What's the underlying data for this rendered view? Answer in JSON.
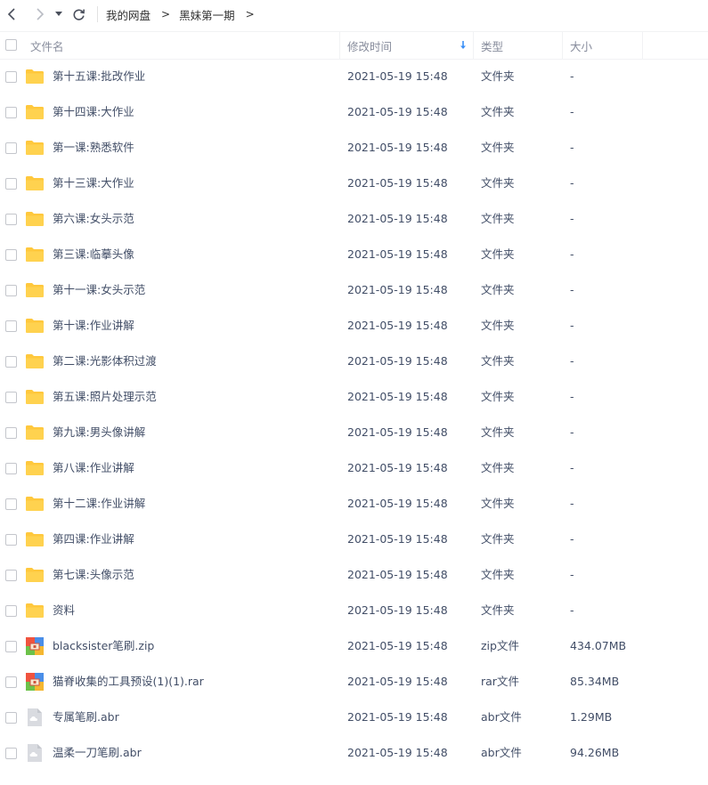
{
  "nav": {
    "back_icon": "chevron-left-icon",
    "forward_icon": "chevron-right-icon",
    "dropdown_icon": "caret-down-icon",
    "refresh_icon": "refresh-icon"
  },
  "breadcrumb": {
    "items": [
      "我的网盘",
      "黑妹第一期"
    ],
    "separator": ">"
  },
  "header": {
    "name": "文件名",
    "time": "修改时间",
    "type": "类型",
    "size": "大小",
    "sort_icon": "sort-down-arrow-icon"
  },
  "colors": {
    "folder": "#ffc83d",
    "zip_red": "#f0533f",
    "zip_green": "#6cc24a",
    "zip_blue": "#4a8ee8",
    "zip_yellow": "#f5b731",
    "abr": "#d9dbe0",
    "sort_arrow": "#3b8ff7"
  },
  "files": [
    {
      "name": "第十五课:批改作业",
      "time": "2021-05-19 15:48",
      "type": "文件夹",
      "size": "-",
      "icon": "folder"
    },
    {
      "name": "第十四课:大作业",
      "time": "2021-05-19 15:48",
      "type": "文件夹",
      "size": "-",
      "icon": "folder"
    },
    {
      "name": "第一课:熟悉软件",
      "time": "2021-05-19 15:48",
      "type": "文件夹",
      "size": "-",
      "icon": "folder"
    },
    {
      "name": "第十三课:大作业",
      "time": "2021-05-19 15:48",
      "type": "文件夹",
      "size": "-",
      "icon": "folder"
    },
    {
      "name": "第六课:女头示范",
      "time": "2021-05-19 15:48",
      "type": "文件夹",
      "size": "-",
      "icon": "folder"
    },
    {
      "name": "第三课:临摹头像",
      "time": "2021-05-19 15:48",
      "type": "文件夹",
      "size": "-",
      "icon": "folder"
    },
    {
      "name": "第十一课:女头示范",
      "time": "2021-05-19 15:48",
      "type": "文件夹",
      "size": "-",
      "icon": "folder"
    },
    {
      "name": "第十课:作业讲解",
      "time": "2021-05-19 15:48",
      "type": "文件夹",
      "size": "-",
      "icon": "folder"
    },
    {
      "name": "第二课:光影体积过渡",
      "time": "2021-05-19 15:48",
      "type": "文件夹",
      "size": "-",
      "icon": "folder"
    },
    {
      "name": "第五课:照片处理示范",
      "time": "2021-05-19 15:48",
      "type": "文件夹",
      "size": "-",
      "icon": "folder"
    },
    {
      "name": "第九课:男头像讲解",
      "time": "2021-05-19 15:48",
      "type": "文件夹",
      "size": "-",
      "icon": "folder"
    },
    {
      "name": "第八课:作业讲解",
      "time": "2021-05-19 15:48",
      "type": "文件夹",
      "size": "-",
      "icon": "folder"
    },
    {
      "name": "第十二课:作业讲解",
      "time": "2021-05-19 15:48",
      "type": "文件夹",
      "size": "-",
      "icon": "folder"
    },
    {
      "name": "第四课:作业讲解",
      "time": "2021-05-19 15:48",
      "type": "文件夹",
      "size": "-",
      "icon": "folder"
    },
    {
      "name": "第七课:头像示范",
      "time": "2021-05-19 15:48",
      "type": "文件夹",
      "size": "-",
      "icon": "folder"
    },
    {
      "name": "资料",
      "time": "2021-05-19 15:48",
      "type": "文件夹",
      "size": "-",
      "icon": "folder"
    },
    {
      "name": "blacksister笔刷.zip",
      "time": "2021-05-19 15:48",
      "type": "zip文件",
      "size": "434.07MB",
      "icon": "zip"
    },
    {
      "name": "猫脊收集的工具预设(1)(1).rar",
      "time": "2021-05-19 15:48",
      "type": "rar文件",
      "size": "85.34MB",
      "icon": "zip"
    },
    {
      "name": "专属笔刷.abr",
      "time": "2021-05-19 15:48",
      "type": "abr文件",
      "size": "1.29MB",
      "icon": "abr"
    },
    {
      "name": "温柔一刀笔刷.abr",
      "time": "2021-05-19 15:48",
      "type": "abr文件",
      "size": "94.26MB",
      "icon": "abr"
    }
  ]
}
